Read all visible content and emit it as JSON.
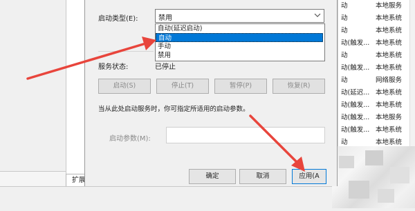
{
  "dialog": {
    "start_type_label": "启动类型(E):",
    "start_type_value": "禁用",
    "start_type_options": [
      "自动(延迟启动)",
      "自动",
      "手动",
      "禁用"
    ],
    "highlighted_option": "自动",
    "service_status_label": "服务状态:",
    "service_status_value": "已停止",
    "buttons": {
      "start": "启动(S)",
      "stop": "停止(T)",
      "pause": "暂停(P)",
      "resume": "恢复(R)"
    },
    "hint_text": "当从此处启动服务时，你可指定所适用的启动参数。",
    "start_param_label": "启动参数(M):",
    "start_param_value": "",
    "footer": {
      "ok": "确定",
      "cancel": "取消",
      "apply": "应用(A"
    }
  },
  "background": {
    "tab_label": "扩展"
  },
  "services_list": [
    {
      "c1": "动",
      "c2": "本地服务"
    },
    {
      "c1": "动",
      "c2": "本地系统"
    },
    {
      "c1": "动",
      "c2": "本地系统"
    },
    {
      "c1": "动(触发...",
      "c2": "本地系统"
    },
    {
      "c1": "动",
      "c2": "本地系统"
    },
    {
      "c1": "动(触发...",
      "c2": "本地系统"
    },
    {
      "c1": "动",
      "c2": "网络服务"
    },
    {
      "c1": "动(延迟...",
      "c2": "本地系统"
    },
    {
      "c1": "动(触发...",
      "c2": "本地系统"
    },
    {
      "c1": "动(触发...",
      "c2": "本地服务"
    },
    {
      "c1": "动(触发...",
      "c2": "本地系统"
    },
    {
      "c1": "动",
      "c2": "本地系统"
    }
  ],
  "colors": {
    "selection": "#0078d7",
    "arrow": "#e8453c"
  }
}
